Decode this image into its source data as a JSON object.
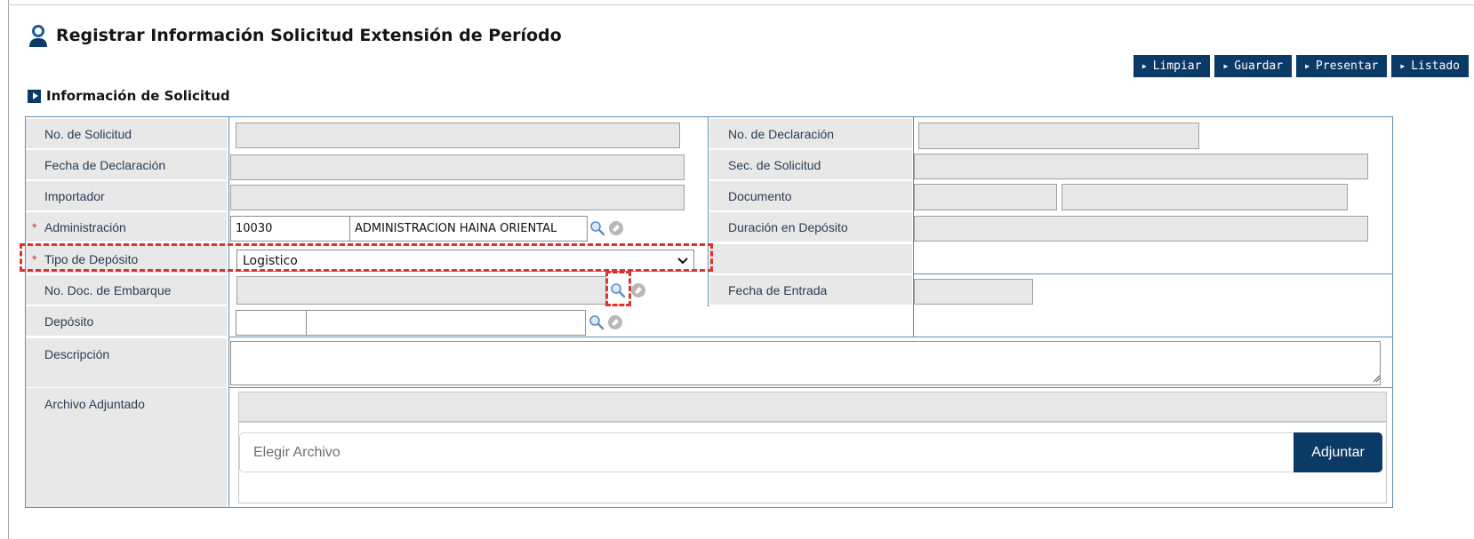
{
  "page": {
    "title": "Registrar Información Solicitud Extensión de Período",
    "section_title": "Información de Solicitud"
  },
  "toolbar": {
    "buttons": [
      {
        "label": "Limpiar"
      },
      {
        "label": "Guardar"
      },
      {
        "label": "Presentar"
      },
      {
        "label": "Listado"
      }
    ]
  },
  "form": {
    "no_solicitud": {
      "label": "No. de Solicitud",
      "value": ""
    },
    "no_declaracion": {
      "label": "No. de Declaración",
      "value": ""
    },
    "fecha_declaracion": {
      "label": "Fecha de Declaración",
      "value": ""
    },
    "sec_solicitud": {
      "label": "Sec. de Solicitud",
      "value": ""
    },
    "importador": {
      "label": "Importador",
      "value": ""
    },
    "documento": {
      "label": "Documento",
      "value_1": "",
      "value_2": ""
    },
    "administracion": {
      "label": "Administración",
      "code": "10030",
      "name": "ADMINISTRACION HAINA ORIENTAL",
      "required_mark": "*"
    },
    "duracion_deposito": {
      "label": "Duración en Depósito",
      "value": ""
    },
    "tipo_deposito": {
      "label": "Tipo de Depósito",
      "value": "Logistico",
      "required_mark": "*"
    },
    "no_doc_embarque": {
      "label": "No. Doc. de Embarque",
      "value": ""
    },
    "fecha_entrada": {
      "label": "Fecha de Entrada",
      "value": ""
    },
    "deposito": {
      "label": "Depósito",
      "code": "",
      "name": ""
    },
    "descripcion": {
      "label": "Descripción",
      "value": ""
    },
    "archivo_adjuntado": {
      "label": "Archivo Adjuntado"
    }
  },
  "attachment": {
    "placeholder": "Elegir Archivo",
    "button_label": "Adjuntar"
  },
  "colors": {
    "brand_navy": "#0c3a66",
    "label_bg": "#e8e8e8",
    "border_blue": "#5e8fb4",
    "highlight_red": "#e03030",
    "required_red": "#c0392b"
  }
}
